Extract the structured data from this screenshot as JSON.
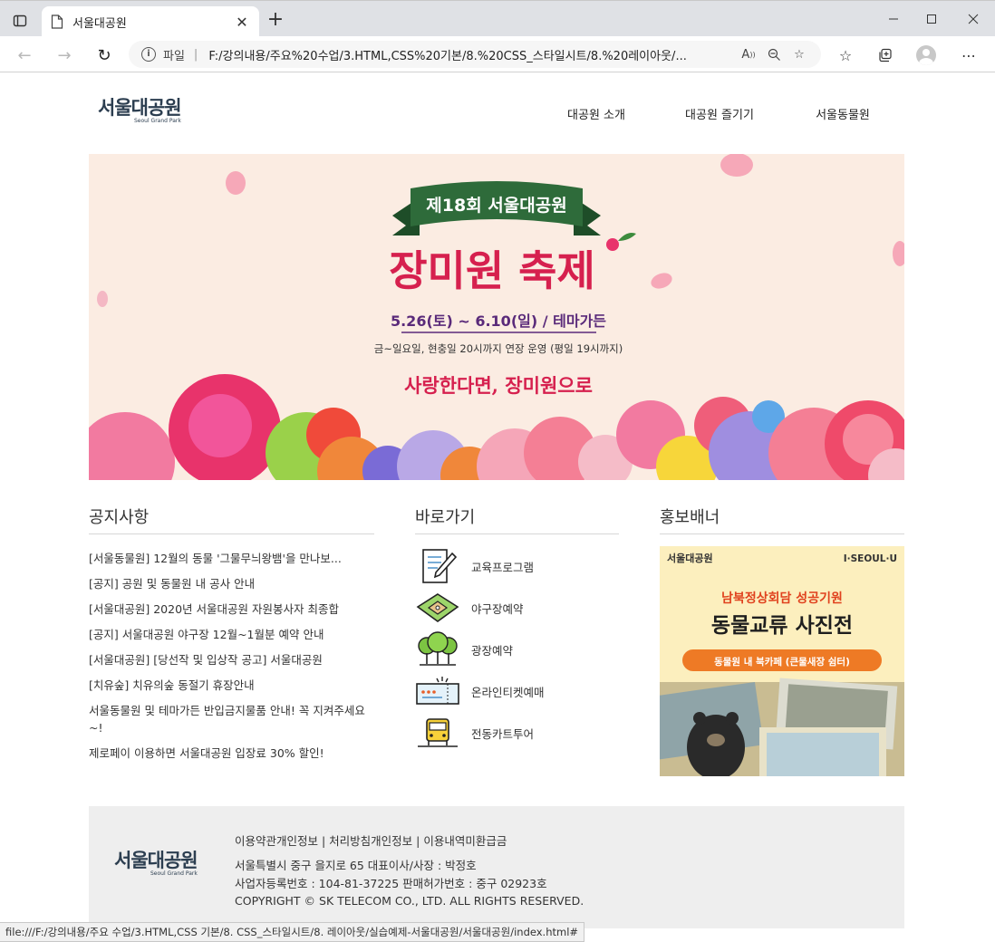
{
  "browser": {
    "tab_title": "서울대공원",
    "url_scheme": "파일",
    "url": "F:/강의내용/주요%20수업/3.HTML,CSS%20기본/8.%20CSS_스타일시트/8.%20레이아웃/..."
  },
  "header": {
    "logo_text": "서울대공원",
    "logo_sub": "Seoul Grand Park",
    "nav": [
      "대공원 소개",
      "대공원 즐기기",
      "서울동물원"
    ]
  },
  "banner": {
    "ribbon": "제18회 서울대공원",
    "title": "장미원 축제",
    "dates": "5.26(토) ~ 6.10(일) /  테마가든",
    "note": "금~일요일, 현충일 20시까지 연장 운영 (평일 19시까지)",
    "slogan": "사랑한다면, 장미원으로"
  },
  "notice": {
    "title": "공지사항",
    "items": [
      "[서울동물원] 12월의 동물 '그물무늬왕뱀'을 만나보...",
      "[공지] 공원 및 동물원 내 공사 안내",
      "[서울대공원] 2020년 서울대공원 자원봉사자 최종합",
      "[공지] 서울대공원 야구장 12월~1월분 예약 안내",
      "[서울대공원] [당선작 및 입상작 공고] 서울대공원",
      "[치유숲] 치유의숲 동절기 휴장안내",
      "서울동물원 및 테마가든 반입금지물품 안내! 꼭 지켜주세요~!",
      "제로페이 이용하면 서울대공원 입장료 30% 할인!"
    ]
  },
  "quick": {
    "title": "바로가기",
    "items": [
      {
        "label": "교육프로그램",
        "icon": "document-pen-icon"
      },
      {
        "label": "야구장예약",
        "icon": "baseball-field-icon"
      },
      {
        "label": "광장예약",
        "icon": "trees-icon"
      },
      {
        "label": "온라인티켓예매",
        "icon": "ticket-icon"
      },
      {
        "label": "전동카트투어",
        "icon": "cart-icon"
      }
    ]
  },
  "promo": {
    "title": "홍보배너",
    "logo": "서울대공원",
    "brand": "I·SEOUL·U",
    "line1": "남북정상회담 성공기원",
    "line2": "동물교류 사진전",
    "pill": "동물원 내 북카페 (큰물새장 쉼터)"
  },
  "footer": {
    "logo_text": "서울대공원",
    "logo_sub": "Seoul Grand Park",
    "links": [
      "이용약관",
      "개인정보 처리방침",
      "개인정보 이용내역",
      "미환급금"
    ],
    "links_text": "이용약관개인정보 | 처리방침개인정보 | 이용내역미환급금",
    "info": [
      "서울특별시 중구 을지로 65 대표이사/사장 : 박정호",
      "사업자등록번호 : 104-81-37225 판매허가번호 : 중구 02923호",
      "COPYRIGHT © SK TELECOM CO., LTD. ALL RIGHTS RESERVED."
    ]
  },
  "status_url": "file:///F:/강의내용/주요 수업/3.HTML,CSS 기본/8. CSS_스타일시트/8. 레이아웃/실습예제-서울대공원/서울대공원/index.html#",
  "colors": {
    "accent_red": "#d6204e",
    "banner_bg": "#fbece2",
    "ribbon_green": "#2e6b3a",
    "promo_bg": "#fcefbe",
    "promo_orange": "#ee7a25"
  }
}
